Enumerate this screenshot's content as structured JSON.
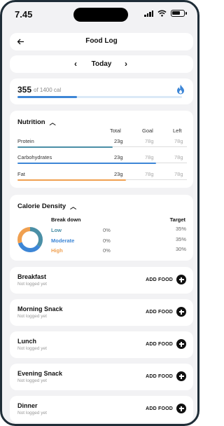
{
  "status_bar": {
    "time": "7.45"
  },
  "header": {
    "title": "Food Log",
    "back_icon": "arrow-left-icon"
  },
  "date_nav": {
    "label": "Today",
    "prev_icon": "chevron-left-icon",
    "next_icon": "chevron-right-icon"
  },
  "calories": {
    "consumed": "355",
    "goal_text": "of 1400 cal",
    "progress_fraction": 0.36,
    "icon": "flame-icon",
    "accent": "#3d86d6"
  },
  "nutrition": {
    "title": "Nutrition",
    "columns": {
      "total": "Total",
      "goal": "Goal",
      "left": "Left"
    },
    "rows": [
      {
        "name": "Protein",
        "total": "23g",
        "goal": "78g",
        "left": "78g",
        "color": "#4a8fa6",
        "fill_fraction": 0.56
      },
      {
        "name": "Carbohydrates",
        "total": "23g",
        "goal": "78g",
        "left": "78g",
        "color": "#3d86d6",
        "fill_fraction": 0.82
      },
      {
        "name": "Fat",
        "total": "23g",
        "goal": "78g",
        "left": "78g",
        "color": "#f0a050",
        "fill_fraction": 0.64
      }
    ]
  },
  "calorie_density": {
    "title": "Calorie Density",
    "breakdown_label": "Break down",
    "target_label": "Target",
    "rows": [
      {
        "name": "Low",
        "percent": "0%",
        "target": "35%",
        "color": "#4a8fa6"
      },
      {
        "name": "Moderate",
        "percent": "0%",
        "target": "35%",
        "color": "#3d86d6"
      },
      {
        "name": "High",
        "percent": "0%",
        "target": "30%",
        "color": "#f0a050"
      }
    ]
  },
  "meals": [
    {
      "name": "Breakfast",
      "status": "Not logged yet",
      "action": "ADD FOOD"
    },
    {
      "name": "Morning Snack",
      "status": "Not logged yet",
      "action": "ADD FOOD"
    },
    {
      "name": "Lunch",
      "status": "Not logged yet",
      "action": "ADD FOOD"
    },
    {
      "name": "Evening Snack",
      "status": "Not logged yet",
      "action": "ADD FOOD"
    },
    {
      "name": "Dinner",
      "status": "Not logged yet",
      "action": "ADD FOOD"
    }
  ]
}
